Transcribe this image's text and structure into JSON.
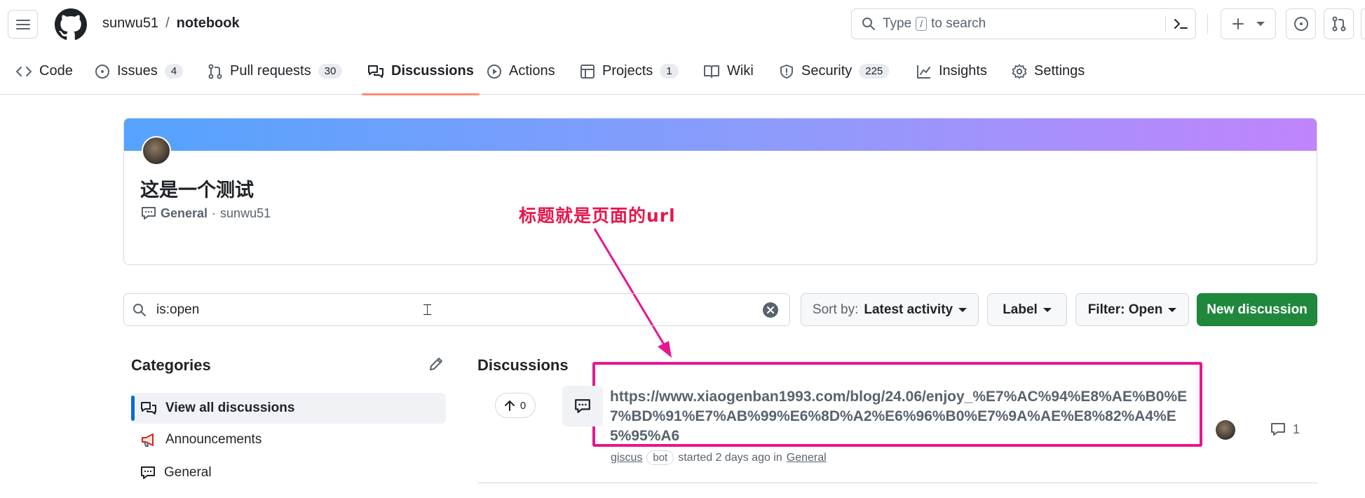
{
  "header": {
    "owner": "sunwu51",
    "separator": "/",
    "repo": "notebook",
    "search_placeholder_before": "Type",
    "search_key": "/",
    "search_placeholder_after": "to search"
  },
  "nav": {
    "tabs": [
      {
        "label": "Code",
        "icon": "code-icon"
      },
      {
        "label": "Issues",
        "icon": "issue-opened-icon",
        "count": "4"
      },
      {
        "label": "Pull requests",
        "icon": "git-pull-request-icon",
        "count": "30"
      },
      {
        "label": "Discussions",
        "icon": "comment-discussion-icon",
        "active": true
      },
      {
        "label": "Actions",
        "icon": "play-icon"
      },
      {
        "label": "Projects",
        "icon": "table-icon",
        "count": "1"
      },
      {
        "label": "Wiki",
        "icon": "book-icon"
      },
      {
        "label": "Security",
        "icon": "shield-icon",
        "count": "225"
      },
      {
        "label": "Insights",
        "icon": "graph-icon"
      },
      {
        "label": "Settings",
        "icon": "gear-icon"
      }
    ]
  },
  "hero": {
    "title": "这是一个测试",
    "category": "General",
    "dot": "·",
    "author": "sunwu51",
    "gradient_colors": [
      "#54a3ff",
      "#c084fc"
    ]
  },
  "annotation": {
    "text": "标题就是页面的url",
    "color": "#e6178f"
  },
  "filters": {
    "query": "is:open",
    "sort_prefix": "Sort by:",
    "sort_value": "Latest activity",
    "label_button": "Label",
    "filter_button": "Filter: Open",
    "new_button": "New discussion"
  },
  "sidebar": {
    "heading": "Categories",
    "items": [
      {
        "label": "View all discussions",
        "icon": "comment-discussion-icon",
        "active": true
      },
      {
        "label": "Announcements",
        "icon": "megaphone-icon"
      },
      {
        "label": "General",
        "icon": "comment-icon"
      }
    ]
  },
  "discussions": {
    "heading": "Discussions",
    "items": [
      {
        "votes": "0",
        "title": "https://www.xiaogenban1993.com/blog/24.06/enjoy_%E7%AC%94%E8%AE%B0%E7%BD%91%E7%AB%99%E6%8D%A2%E6%96%B0%E7%9A%AE%E8%82%A4%E5%95%A6",
        "author": "giscus",
        "badge": "bot",
        "started": "started 2 days ago in",
        "category": "General",
        "comments": "1"
      }
    ]
  },
  "colors": {
    "accent": "#0969da",
    "primary_button": "#1f883d",
    "active_tab_underline": "#fd8c73"
  }
}
